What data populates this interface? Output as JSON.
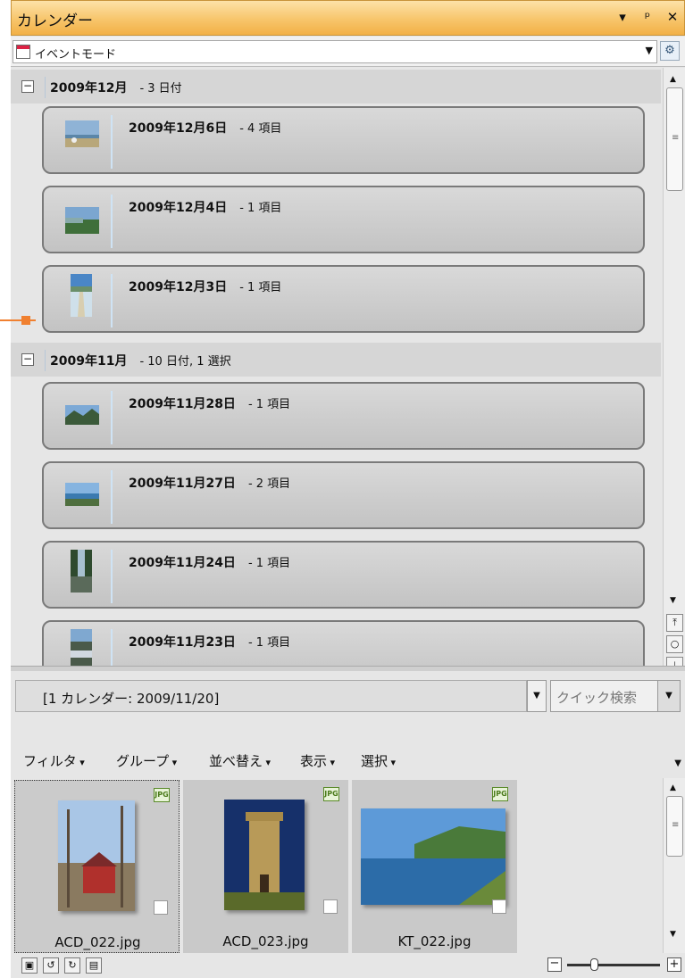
{
  "window": {
    "title": "カレンダー",
    "controls": [
      "▾",
      "ᵖ",
      "✕"
    ]
  },
  "mode": {
    "label": "イベントモード"
  },
  "groups": [
    {
      "title": "2009年12月",
      "count": "- 3 日付",
      "days": [
        {
          "title": "2009年12月6日",
          "count": "- 4 項目"
        },
        {
          "title": "2009年12月4日",
          "count": "- 1 項目"
        },
        {
          "title": "2009年12月3日",
          "count": "- 1 項目"
        }
      ]
    },
    {
      "title": "2009年11月",
      "count": "- 10 日付, 1 選択",
      "days": [
        {
          "title": "2009年11月28日",
          "count": "- 1 項目"
        },
        {
          "title": "2009年11月27日",
          "count": "- 2 項目"
        },
        {
          "title": "2009年11月24日",
          "count": "- 1 項目"
        },
        {
          "title": "2009年11月23日",
          "count": "- 1 項目"
        }
      ]
    }
  ],
  "path": {
    "text": "[1 カレンダー: 2009/11/20]"
  },
  "quick_search": {
    "placeholder": "クイック検索"
  },
  "menu": [
    "フィルタ",
    "グループ",
    "並べ替え",
    "表示",
    "選択"
  ],
  "files": [
    {
      "name": "ACD_022.jpg",
      "badge": "JPG"
    },
    {
      "name": "ACD_023.jpg",
      "badge": "JPG"
    },
    {
      "name": "KT_022.jpg",
      "badge": "JPG"
    }
  ]
}
